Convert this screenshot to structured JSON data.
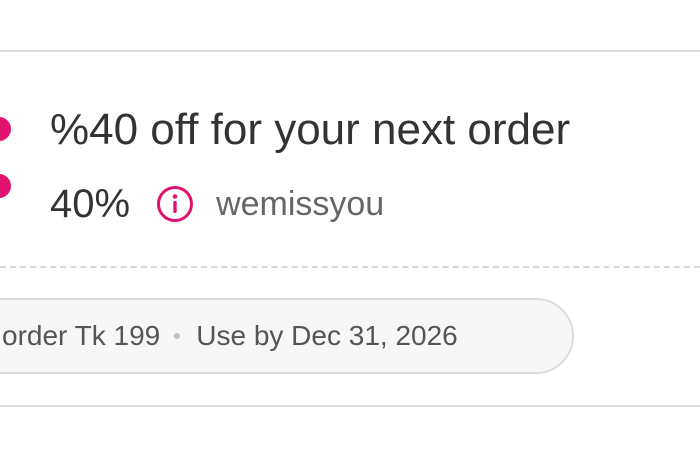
{
  "voucher": {
    "title": "%40 off for your next order",
    "discount": "40%",
    "code": "wemissyou",
    "min_order": "order Tk 199",
    "expiry": "Use by Dec 31, 2026",
    "accent_color": "#e2136e",
    "info_icon": "info-circle-icon"
  }
}
